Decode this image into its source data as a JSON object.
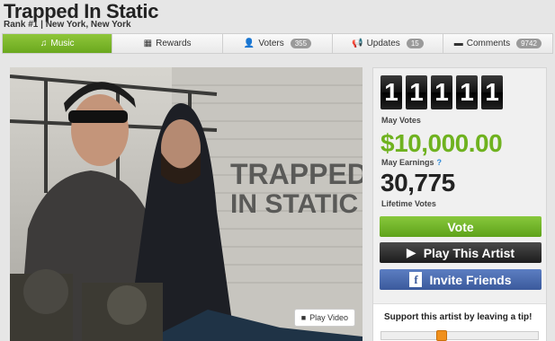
{
  "artist": {
    "name": "Trapped In Static",
    "rank_line": "Rank #1 | New York, New York"
  },
  "tabs": [
    {
      "label": "Music",
      "icon": "music-note-icon",
      "active": true
    },
    {
      "label": "Rewards",
      "icon": "grid-icon",
      "active": false
    },
    {
      "label": "Voters",
      "icon": "user-icon",
      "badge": "355",
      "active": false
    },
    {
      "label": "Updates",
      "icon": "megaphone-icon",
      "badge": "15",
      "active": false
    },
    {
      "label": "Comments",
      "icon": "comment-icon",
      "badge": "9742",
      "active": false
    }
  ],
  "photo": {
    "overlay_text_line1": "TRAPPED",
    "overlay_text_line2": "IN STATIC",
    "play_video_label": "Play Video"
  },
  "stats": {
    "vote_digits": [
      "1",
      "1",
      "1",
      "1",
      "1"
    ],
    "may_votes_label": "May Votes",
    "may_earnings_value": "$10,000.00",
    "may_earnings_label": "May Earnings",
    "help_glyph": "?",
    "lifetime_votes_value": "30,775",
    "lifetime_votes_label": "Lifetime Votes"
  },
  "actions": {
    "vote_label": "Vote",
    "play_label": "Play This Artist",
    "invite_label": "Invite Friends",
    "fb_glyph": "f"
  },
  "tip": {
    "text": "Support this artist by leaving a tip!",
    "slider_level": 0.37
  },
  "colors": {
    "accent_green": "#6fb21f",
    "facebook_blue": "#3b5a9c",
    "tip_handle": "#f0901c"
  }
}
